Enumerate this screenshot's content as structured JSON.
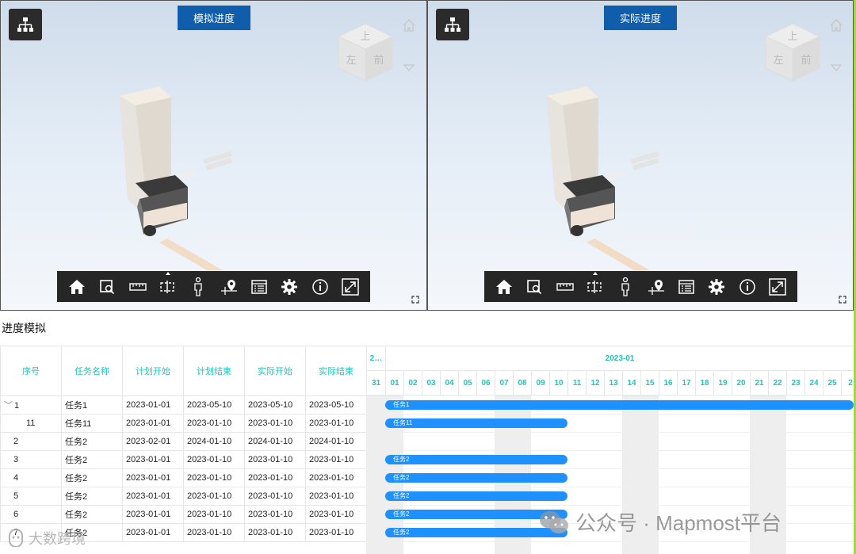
{
  "viewers": [
    {
      "title": "模拟进度",
      "cube_faces": [
        "上",
        "左",
        "前"
      ]
    },
    {
      "title": "实际进度",
      "cube_faces": [
        "上",
        "左",
        "前"
      ]
    }
  ],
  "toolbar_icons": [
    "home-icon",
    "section-box-icon",
    "measure-ruler-icon",
    "section-plane-icon",
    "person-walk-icon",
    "location-pin-icon",
    "list-panel-icon",
    "settings-gear-icon",
    "info-icon",
    "fullscreen-icon"
  ],
  "section_title": "进度模拟",
  "table": {
    "headers": [
      "序号",
      "任务名称",
      "计划开始",
      "计划结束",
      "实际开始",
      "实际结束"
    ],
    "rows": [
      {
        "idx": "1",
        "name": "任务1",
        "ps": "2023-01-01",
        "pe": "2023-05-10",
        "as": "2023-05-10",
        "ae": "2023-05-10",
        "level": "parent",
        "bar": {
          "start": 1,
          "end": 30,
          "label": "任务1"
        }
      },
      {
        "idx": "11",
        "name": "任务11",
        "ps": "2023-01-01",
        "pe": "2023-01-10",
        "as": "2023-01-10",
        "ae": "2023-01-10",
        "level": "child",
        "bar": {
          "start": 1,
          "end": 10,
          "label": "任务11"
        }
      },
      {
        "idx": "2",
        "name": "任务2",
        "ps": "2023-02-01",
        "pe": "2024-01-10",
        "as": "2024-01-10",
        "ae": "2024-01-10",
        "level": "top",
        "bar": null
      },
      {
        "idx": "3",
        "name": "任务2",
        "ps": "2023-01-01",
        "pe": "2023-01-10",
        "as": "2023-01-10",
        "ae": "2023-01-10",
        "level": "top",
        "bar": {
          "start": 1,
          "end": 10,
          "label": "任务2"
        }
      },
      {
        "idx": "4",
        "name": "任务2",
        "ps": "2023-01-01",
        "pe": "2023-01-10",
        "as": "2023-01-10",
        "ae": "2023-01-10",
        "level": "top",
        "bar": {
          "start": 1,
          "end": 10,
          "label": "任务2"
        }
      },
      {
        "idx": "5",
        "name": "任务2",
        "ps": "2023-01-01",
        "pe": "2023-01-10",
        "as": "2023-01-10",
        "ae": "2023-01-10",
        "level": "top",
        "bar": {
          "start": 1,
          "end": 10,
          "label": "任务2"
        }
      },
      {
        "idx": "6",
        "name": "任务2",
        "ps": "2023-01-01",
        "pe": "2023-01-10",
        "as": "2023-01-10",
        "ae": "2023-01-10",
        "level": "top",
        "bar": {
          "start": 1,
          "end": 10,
          "label": "任务2"
        }
      },
      {
        "idx": "7",
        "name": "任务2",
        "ps": "2023-01-01",
        "pe": "2023-01-10",
        "as": "2023-01-10",
        "ae": "2023-01-10",
        "level": "top",
        "bar": {
          "start": 1,
          "end": 10,
          "label": "任务2"
        }
      }
    ]
  },
  "timeline": {
    "prev_month": "2…",
    "month": "2023-01",
    "days": [
      "31",
      "01",
      "02",
      "03",
      "04",
      "05",
      "06",
      "07",
      "08",
      "09",
      "10",
      "11",
      "12",
      "13",
      "14",
      "15",
      "16",
      "17",
      "18",
      "19",
      "20",
      "21",
      "22",
      "23",
      "24",
      "25",
      "2"
    ],
    "weekend_days": [
      "31",
      "01",
      "07",
      "08",
      "14",
      "15",
      "21",
      "22"
    ]
  },
  "watermarks": {
    "right": "公众号 · Mapmost平台",
    "left": "大数跨境"
  },
  "colors": {
    "accent": "#1ec7b6",
    "bar": "#1e90ff",
    "title_bg": "#0f5dab",
    "toolbar_bg": "#262626"
  }
}
